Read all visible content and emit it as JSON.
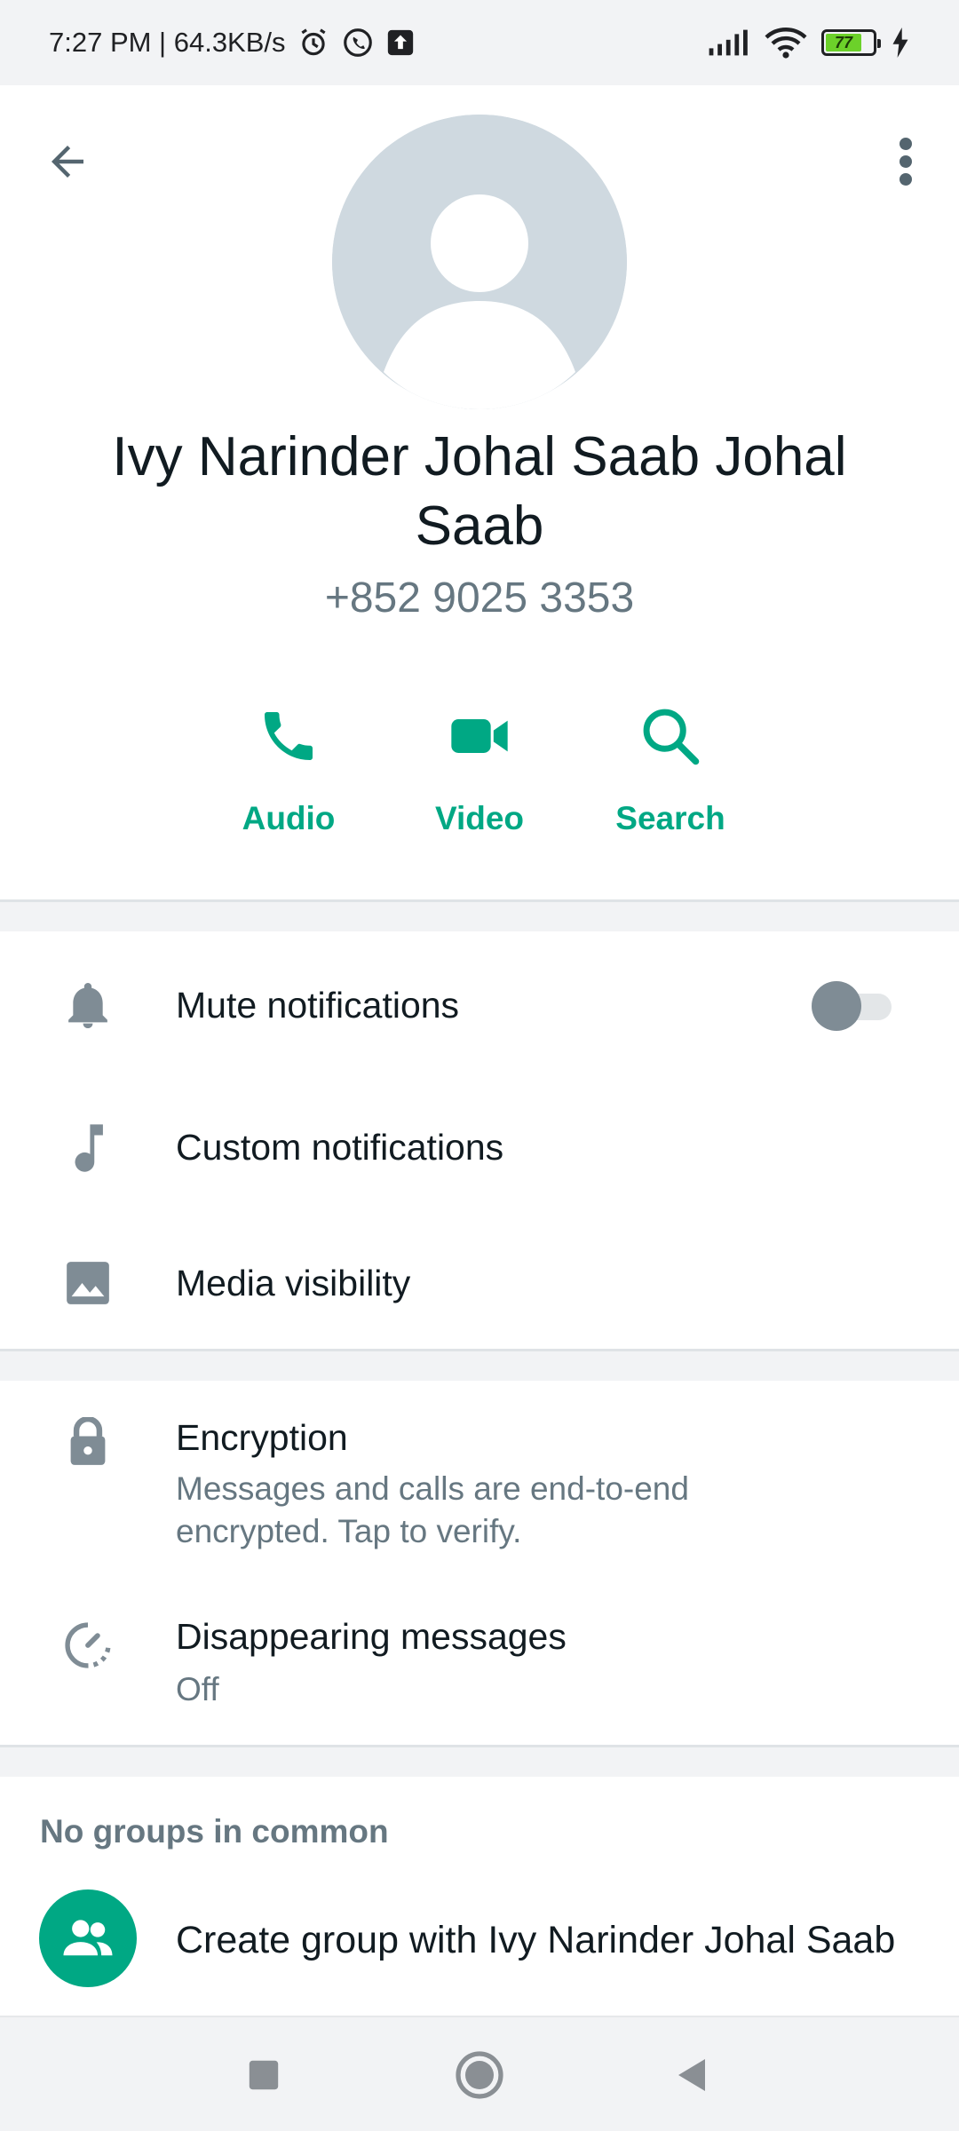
{
  "status_bar": {
    "time_speed": "7:27 PM | 64.3KB/s",
    "battery_level": "77",
    "icons": [
      "alarm-icon",
      "whatsapp-icon",
      "upload-icon",
      "signal-icon",
      "wifi-icon",
      "battery-icon",
      "charging-icon"
    ]
  },
  "contact": {
    "name": "Ivy Narinder Johal Saab Johal Saab",
    "phone": "+852 9025 3353"
  },
  "actions": [
    {
      "label": "Audio",
      "icon": "phone-icon"
    },
    {
      "label": "Video",
      "icon": "videocam-icon"
    },
    {
      "label": "Search",
      "icon": "search-icon"
    }
  ],
  "settings": {
    "mute": {
      "label": "Mute notifications",
      "enabled": false
    },
    "custom": {
      "label": "Custom notifications"
    },
    "media": {
      "label": "Media visibility"
    }
  },
  "privacy": {
    "encryption": {
      "label": "Encryption",
      "sub_line1": "Messages and calls are end-to-end",
      "sub_line2": "encrypted. Tap to verify."
    },
    "disappearing": {
      "label": "Disappearing messages",
      "value": "Off"
    }
  },
  "groups": {
    "title": "No groups in common",
    "create_label": "Create group with Ivy Narinder Johal Saab"
  },
  "colors": {
    "accent": "#00a884",
    "secondary_text": "#667781",
    "icon_gray": "#7f8c95",
    "avatar_bg": "#cfd9e0"
  }
}
